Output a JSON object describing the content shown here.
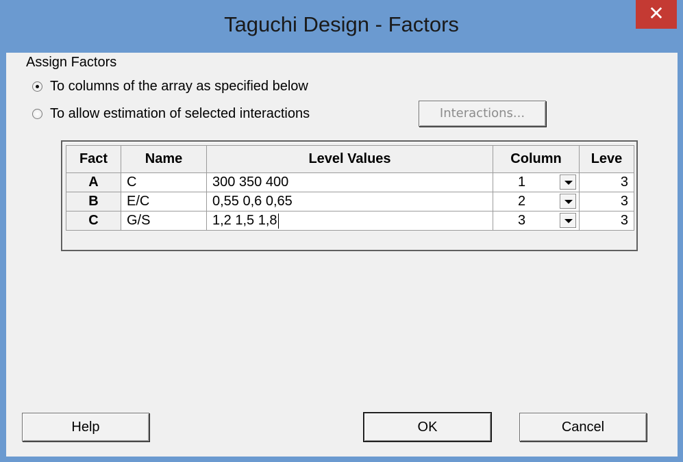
{
  "window": {
    "title": "Taguchi Design - Factors",
    "close_glyph": "✕"
  },
  "assign": {
    "group_label": "Assign Factors",
    "option1_label": "To columns of the array as specified below",
    "option2_label": "To allow estimation of selected interactions",
    "selected": "option1",
    "interactions_button": "Interactions..."
  },
  "table": {
    "headers": [
      "Fact",
      "Name",
      "Level Values",
      "Column",
      "Leve"
    ],
    "rows": [
      {
        "fact": "A",
        "name": "C",
        "levels": "300 350 400",
        "column": "1",
        "leve": "3"
      },
      {
        "fact": "B",
        "name": "E/C",
        "levels": "0,55 0,6 0,65",
        "column": "2",
        "leve": "3"
      },
      {
        "fact": "C",
        "name": "G/S",
        "levels": "1,2 1,5 1,8",
        "column": "3",
        "leve": "3"
      }
    ]
  },
  "buttons": {
    "help": "Help",
    "ok": "OK",
    "cancel": "Cancel"
  },
  "colors": {
    "frame": "#6b9ad0",
    "close": "#c43a33",
    "client": "#f0f0f0"
  }
}
